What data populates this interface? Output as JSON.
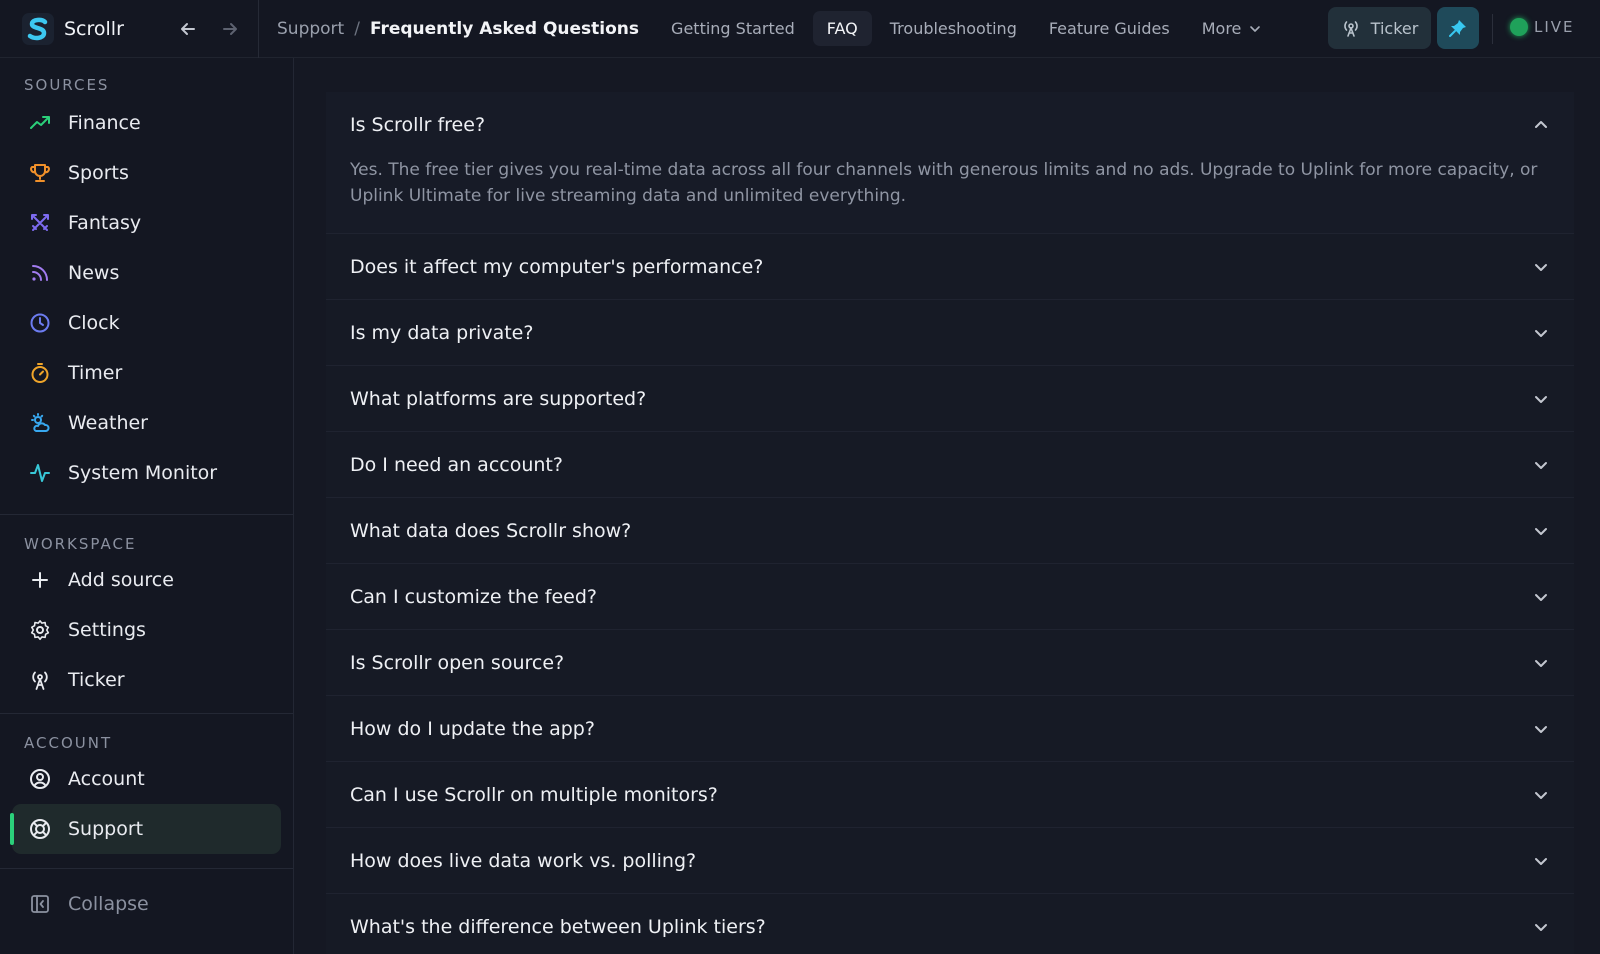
{
  "app": {
    "name": "Scrollr"
  },
  "breadcrumb": {
    "parent": "Support",
    "separator": "/",
    "current": "Frequently Asked Questions"
  },
  "tabs": [
    {
      "label": "Getting Started",
      "active": false
    },
    {
      "label": "FAQ",
      "active": true
    },
    {
      "label": "Troubleshooting",
      "active": false
    },
    {
      "label": "Feature Guides",
      "active": false
    }
  ],
  "more_label": "More",
  "header_actions": {
    "ticker_label": "Ticker",
    "pin_icon": "pin-icon",
    "live_label": "LIVE"
  },
  "sidebar": {
    "sources_title": "SOURCES",
    "sources": [
      {
        "label": "Finance",
        "icon": "trending-up-icon",
        "color": "#2bd07a"
      },
      {
        "label": "Sports",
        "icon": "trophy-icon",
        "color": "#f0902a"
      },
      {
        "label": "Fantasy",
        "icon": "crossed-swords-icon",
        "color": "#7d6bf0"
      },
      {
        "label": "News",
        "icon": "rss-icon",
        "color": "#a27cf0"
      },
      {
        "label": "Clock",
        "icon": "clock-icon",
        "color": "#6c7cf0"
      },
      {
        "label": "Timer",
        "icon": "timer-icon",
        "color": "#f0a52a"
      },
      {
        "label": "Weather",
        "icon": "weather-icon",
        "color": "#38a8f0"
      },
      {
        "label": "System Monitor",
        "icon": "activity-icon",
        "color": "#38c8d8"
      }
    ],
    "workspace_title": "WORKSPACE",
    "workspace": [
      {
        "label": "Add source",
        "icon": "plus-icon"
      },
      {
        "label": "Settings",
        "icon": "gear-icon"
      },
      {
        "label": "Ticker",
        "icon": "broadcast-icon"
      }
    ],
    "account_title": "ACCOUNT",
    "account": [
      {
        "label": "Account",
        "icon": "user-circle-icon"
      },
      {
        "label": "Support",
        "icon": "lifebuoy-icon",
        "active": true
      }
    ],
    "collapse_label": "Collapse"
  },
  "faq": {
    "items": [
      {
        "q": "Is Scrollr free?",
        "open": true,
        "a": "Yes. The free tier gives you real-time data across all four channels with generous limits and no ads. Upgrade to Uplink for more capacity, or Uplink Ultimate for live streaming data and unlimited everything."
      },
      {
        "q": "Does it affect my computer's performance?",
        "open": false
      },
      {
        "q": "Is my data private?",
        "open": false
      },
      {
        "q": "What platforms are supported?",
        "open": false
      },
      {
        "q": "Do I need an account?",
        "open": false
      },
      {
        "q": "What data does Scrollr show?",
        "open": false
      },
      {
        "q": "Can I customize the feed?",
        "open": false
      },
      {
        "q": "Is Scrollr open source?",
        "open": false
      },
      {
        "q": "How do I update the app?",
        "open": false
      },
      {
        "q": "Can I use Scrollr on multiple monitors?",
        "open": false
      },
      {
        "q": "How does live data work vs. polling?",
        "open": false
      },
      {
        "q": "What's the difference between Uplink tiers?",
        "open": false
      }
    ]
  },
  "colors": {
    "accent": "#2bd07a",
    "live": "#1fa15a",
    "pin": "#38c8f0"
  }
}
